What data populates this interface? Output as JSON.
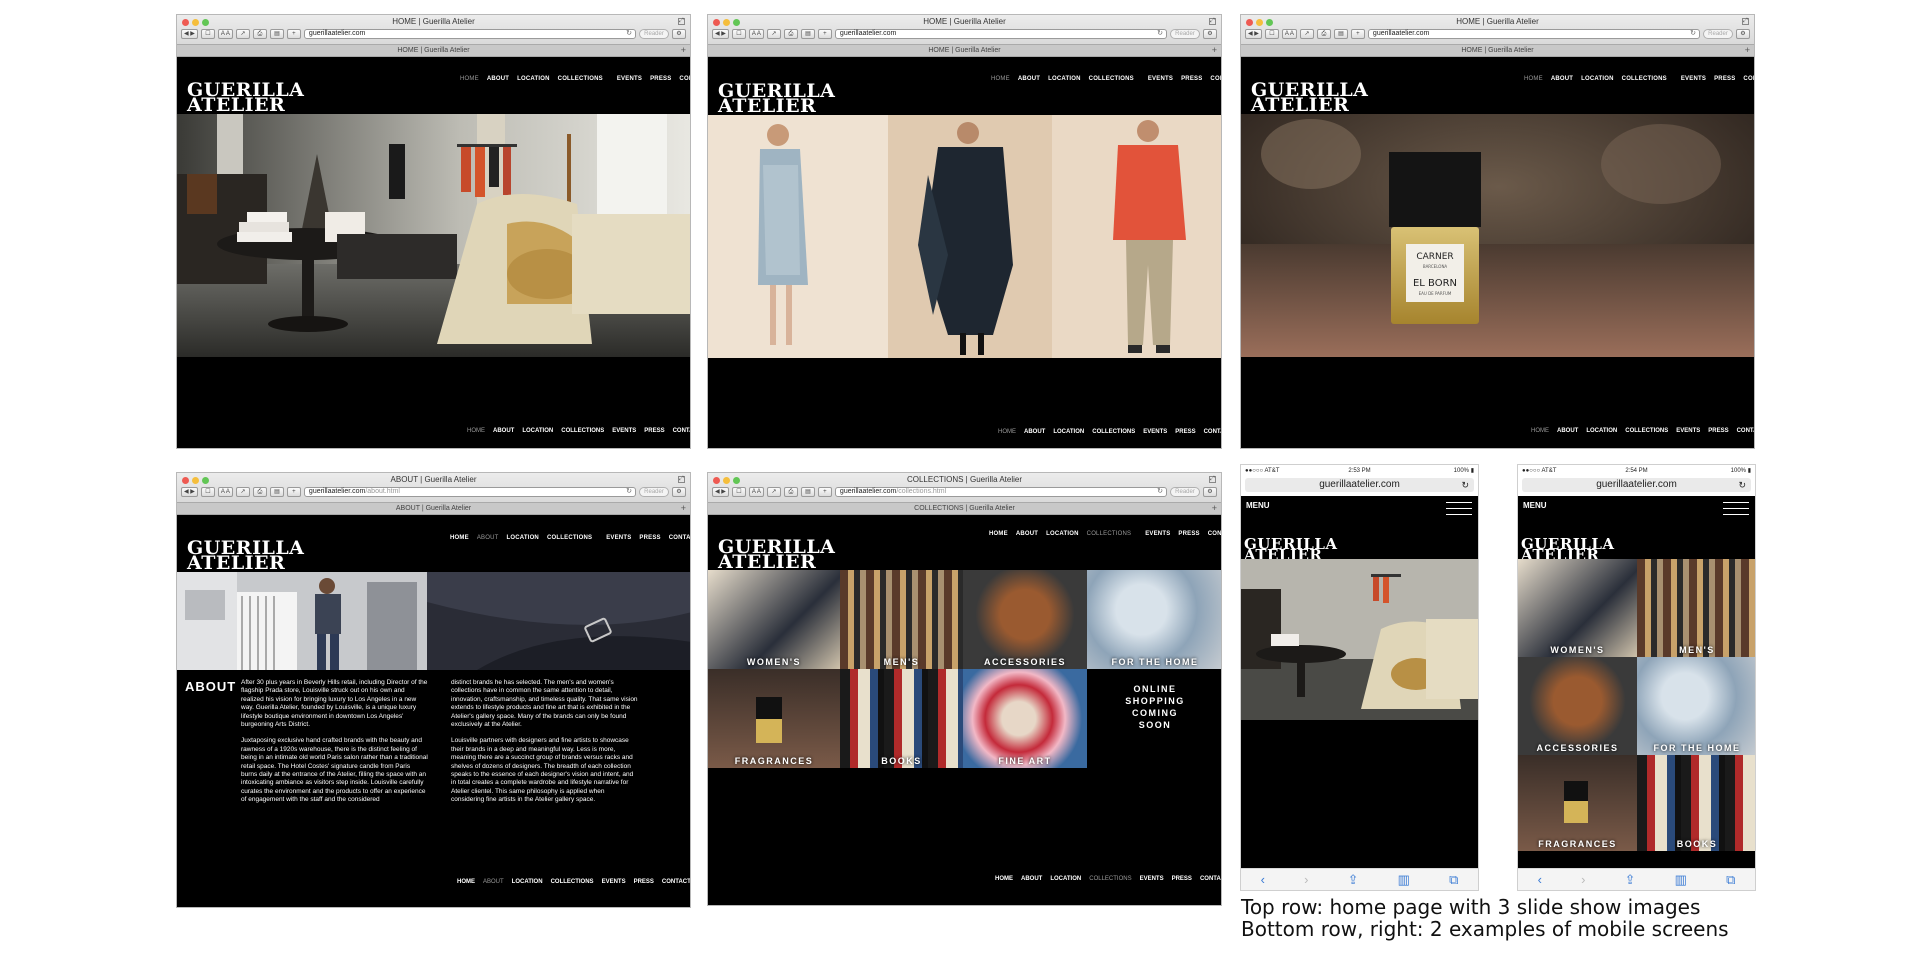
{
  "url": "guerillaatelier.com",
  "logo": "GUERILLA ATELIER",
  "nav": {
    "group1": [
      "HOME",
      "ABOUT",
      "LOCATION",
      "COLLECTIONS"
    ],
    "group2": [
      "EVENTS",
      "PRESS",
      "CONTACT"
    ]
  },
  "desktop": {
    "home_title": "HOME | Guerilla Atelier",
    "about_title": "ABOUT | Guerilla Atelier",
    "collections_title": "COLLECTIONS | Guerilla Atelier",
    "about_url": "guerillaatelier.com",
    "about_path": "/about.html",
    "collections_url": "guerillaatelier.com",
    "collections_path": "/collections.html",
    "reader": "Reader"
  },
  "about": {
    "heading": "ABOUT",
    "col1_p1": "After 30 plus years in Beverly Hills retail, including Director of the flagship Prada store, Louisville struck out on his own and realized his vision for bringing luxury to Los Angeles in a new way. Guerilla Atelier, founded by Louisville, is a unique luxury lifestyle boutique environment in downtown Los Angeles' burgeoning Arts District.",
    "col1_p2": "Juxtaposing exclusive hand crafted brands with the beauty and rawness of a 1920s warehouse, there is the distinct feeling of being in an intimate old world Paris salon rather than a traditional retail space. The Hotel Costes' signature candle from Paris burns daily at the entrance of the Atelier, filling the space with an intoxicating ambiance as visitors step inside. Louisville carefully curates the environment and the products to offer an experience of engagement with the staff and the considered",
    "col2_p1": "distinct brands he has selected. The men's and women's collections have in common the same attention to detail, innovation, craftsmanship, and timeless quality. That same vision extends to lifestyle products and fine art that is exhibited in the Atelier's gallery space. Many of the brands can only be found exclusively at the Atelier.",
    "col2_p2": "Louisville partners with designers and fine artists to showcase their brands in a deep and meaningful way. Less is more, meaning there are a succinct group of brands versus racks and shelves of dozens of designers. The breadth of each collection speaks to the essence of each designer's vision and intent, and in total creates a complete wardrobe and lifestyle narrative for Atelier clientel. This same philosophy is applied when considering fine artists in the Atelier gallery space."
  },
  "collections": {
    "tiles": [
      "WOMEN'S",
      "MEN'S",
      "ACCESSORIES",
      "FOR THE HOME",
      "FRAGRANCES",
      "BOOKS",
      "FINE ART"
    ],
    "online_line1": "ONLINE",
    "online_line2": "SHOPPING",
    "online_line3": "COMING",
    "online_line4": "SOON"
  },
  "perfume": {
    "brand": "CARNER",
    "sub": "BARCELONA",
    "name": "EL BORN",
    "desc": "EAU DE PARFUM"
  },
  "mobile": {
    "carrier": "AT&T",
    "time1": "2:53 PM",
    "time2": "2:54 PM",
    "battery": "100%",
    "menu": "MENU",
    "tiles": [
      "WOMEN'S",
      "MEN'S",
      "ACCESSORIES",
      "FOR THE HOME",
      "FRAGRANCES",
      "BOOKS"
    ]
  },
  "caption": {
    "line1": "Top row: home page with 3 slide show images",
    "line2": "Bottom row, right: 2 examples of mobile screens"
  }
}
